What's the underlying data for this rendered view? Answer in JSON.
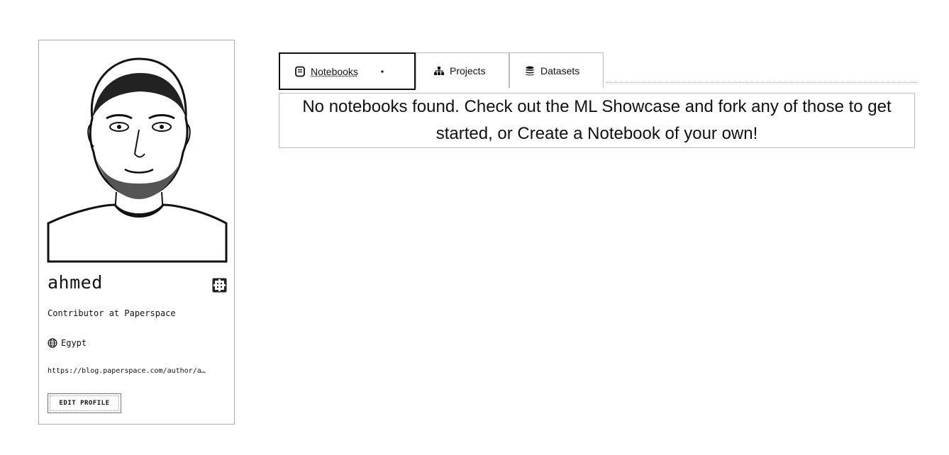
{
  "profile": {
    "username": "ahmed",
    "title": "Contributor at Paperspace",
    "location": "Egypt",
    "link": "https://blog.paperspace.com/author/a…",
    "edit_label": "EDIT PROFILE"
  },
  "tabs": [
    {
      "label": "Notebooks",
      "icon": "notebook-icon",
      "active": true
    },
    {
      "label": "Projects",
      "icon": "hierarchy-icon",
      "active": false
    },
    {
      "label": "Datasets",
      "icon": "database-icon",
      "active": false
    }
  ],
  "empty_state": {
    "message": "No notebooks found. Check out the ML Showcase and fork any of those to get started, or Create a Notebook of your own!"
  }
}
